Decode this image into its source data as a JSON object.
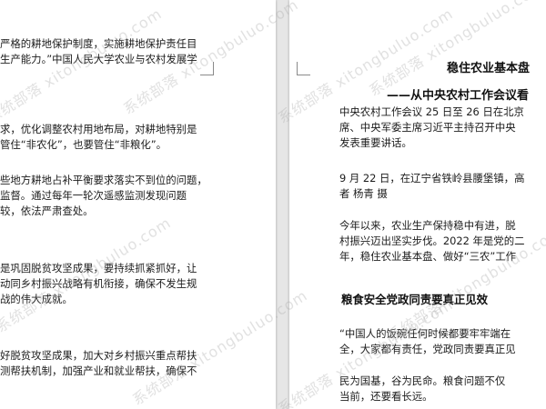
{
  "left_page": {
    "para1": [
      "严格的耕地保护制度，实施耕地保护责任目",
      "生产能力。”中国人民大学农业与农村发展学"
    ],
    "para2": [
      "求，优化调整农村用地布局，对耕地特别是",
      "管住“非农化”，也要管住“非粮化”。"
    ],
    "para3": [
      "些地方耕地占补平衡要求落实不到位的问题，",
      "监督。通过每年一轮次遥感监测发现问题",
      "较，依法严肃查处。"
    ],
    "para4": [
      "是巩固脱贫攻坚成果，要持续抓紧抓好，让",
      "动同乡村振兴战略有机衔接，确保不发生规",
      "战的伟大成就。"
    ],
    "para5": [
      "好脱贫攻坚成果，加大对乡村振兴重点帮扶",
      "测帮扶机制，加强产业和就业帮扶，确保不"
    ]
  },
  "right_page": {
    "title": "稳住农业基本盘",
    "subtitle": "——从中央农村工作会议看",
    "para1": [
      "中央农村工作会议 25 日至 26 日在北京",
      "席、中央军委主席习近平主持召开中央",
      "发表重要讲话。"
    ],
    "para2": [
      "9 月 22 日，在辽宁省铁岭县腰堡镇，高",
      "者  杨青  摄"
    ],
    "para3": [
      "今年以来，农业生产保持稳中有进，脱",
      "村振兴迈出坚实步伐。2022 年是党的二",
      "年，稳住农业基本盘、做好“三农”工作"
    ],
    "heading": "粮食安全党政同责要真正见效",
    "para4": [
      "“中国人的饭碗任何时候都要牢牢端在",
      "全，大家都有责任，党政同责要真正见"
    ],
    "para5": [
      "民为国基，谷为民命。粮食问题不仅",
      "当前，还要看长远。"
    ]
  },
  "watermark": "系统部落 xitongbuluo.com"
}
